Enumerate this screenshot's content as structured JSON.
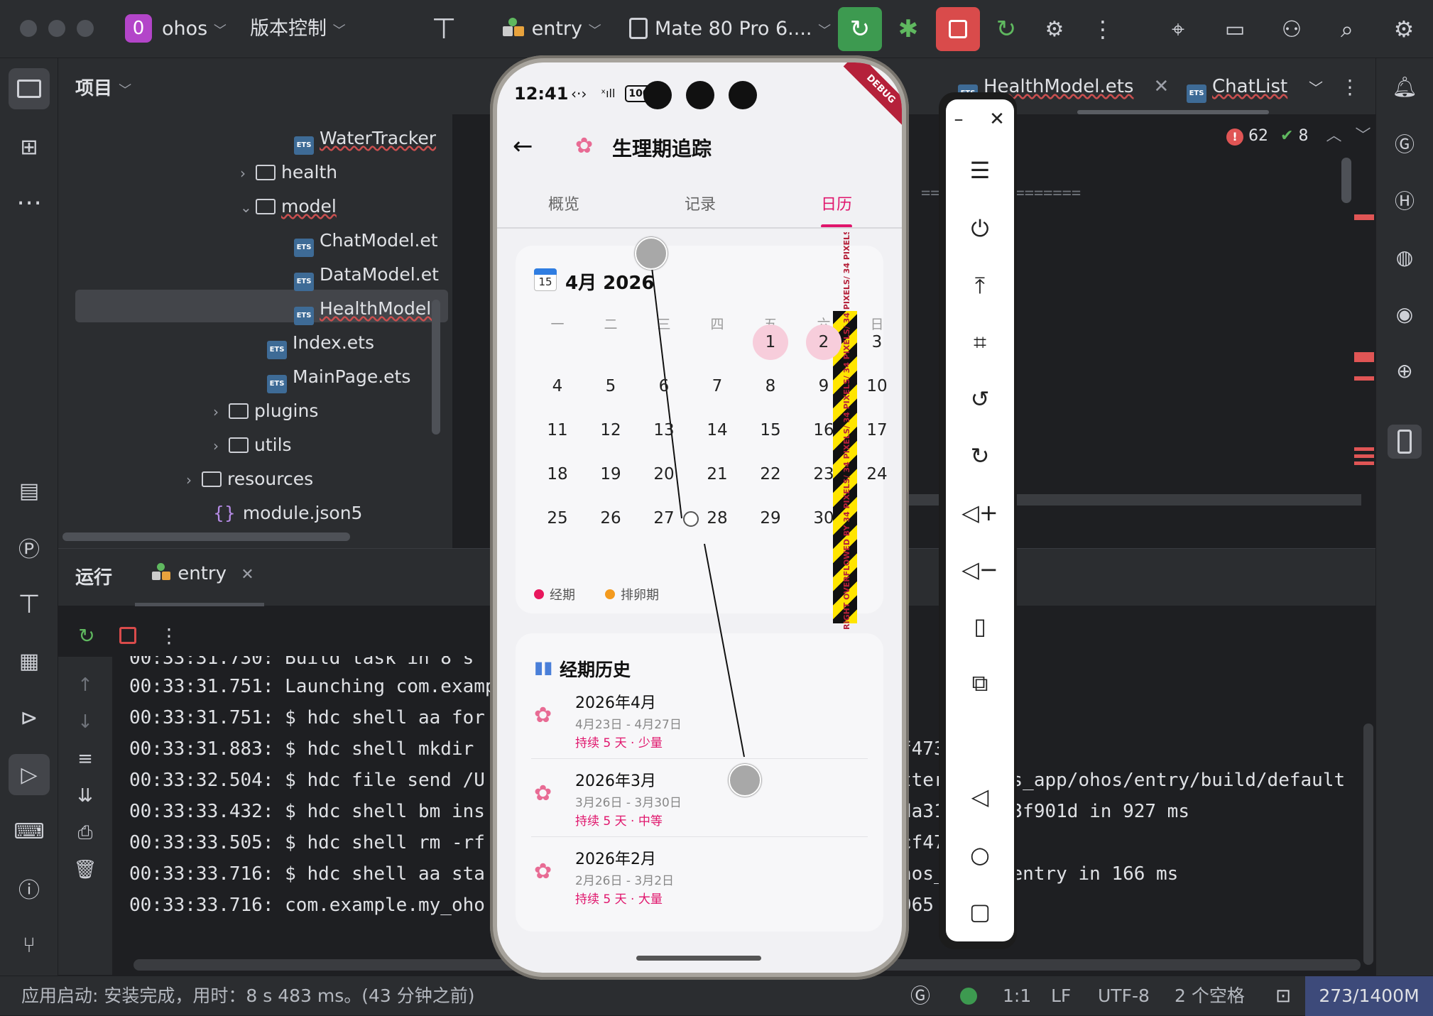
{
  "titlebar": {
    "project_badge": "0",
    "project_name": "ohos",
    "vcs_menu": "版本控制",
    "run_config": "entry",
    "device": "Mate 80 Pro 6....",
    "colors": {
      "run_green": "#3d9a50",
      "stop_red": "#d94b4b",
      "badge_purple": "#b345c9"
    }
  },
  "project_panel": {
    "title": "项目",
    "tree": [
      {
        "label": "WaterTracker",
        "kind": "ets"
      },
      {
        "label": "health",
        "kind": "folder-collapsed"
      },
      {
        "label": "model",
        "kind": "folder-expanded"
      },
      {
        "label": "ChatModel.et",
        "kind": "ets"
      },
      {
        "label": "DataModel.et",
        "kind": "ets"
      },
      {
        "label": "HealthModel.",
        "kind": "ets",
        "selected": true
      },
      {
        "label": "Index.ets",
        "kind": "ets"
      },
      {
        "label": "MainPage.ets",
        "kind": "ets"
      },
      {
        "label": "plugins",
        "kind": "folder-collapsed"
      },
      {
        "label": "utils",
        "kind": "folder-collapsed"
      },
      {
        "label": "resources",
        "kind": "folder-collapsed"
      },
      {
        "label": "module.json5",
        "kind": "json"
      }
    ]
  },
  "editor": {
    "tabs": [
      {
        "label": "HealthModel.ets"
      },
      {
        "label": "ChatList"
      }
    ],
    "error_count": "62",
    "warning_count": "8",
    "code_fragment": "==  ============="
  },
  "run_panel": {
    "title": "运行",
    "tab_label": "entry",
    "log_lines": [
      "00:33:31.730: Build task in 8 s",
      "00:33:31.751: Launching com.examp",
      "00:33:31.751: $ hdc shell aa for",
      "00:33:31.883: $ hdc shell mkdir",
      "00:33:32.504: $ hdc file send /U",
      "00:33:33.432: $ hdc shell bm ins",
      "00:33:33.505: $ hdc shell rm -rf",
      "00:33:33.716: $ hdc shell aa sta",
      "00:33:33.716: com.example.my_oho"
    ],
    "log_right": [
      {
        "line": 3,
        "text": "f473"
      },
      {
        "line": 4,
        "text": "tter     os_app/ohos/entry/build/default"
      },
      {
        "line": 5,
        "text": "da31     73f901d in 927 ms"
      },
      {
        "line": 6,
        "text": "cf47"
      },
      {
        "line": 7,
        "text": "hos_      entry in 166 ms"
      },
      {
        "line": 8,
        "text": "965"
      }
    ]
  },
  "statusbar": {
    "message": "应用启动: 安装完成，用时：8 s 483 ms。(43 分钟之前)",
    "position": "1:1",
    "line_ending": "LF",
    "encoding": "UTF-8",
    "indent": "2 个空格",
    "memory": "273/1400M"
  },
  "phone": {
    "time": "12:41",
    "battery": "100",
    "debug_ribbon": "DEBUG",
    "app_title": "生理期追踪",
    "tabs": [
      {
        "label": "概览"
      },
      {
        "label": "记录"
      },
      {
        "label": "日历",
        "active": true
      }
    ],
    "calendar": {
      "month_label": "4月 2026",
      "icon_day": "15",
      "weekdays": [
        "一",
        "二",
        "三",
        "四",
        "五",
        "六",
        "日"
      ],
      "rows": [
        [
          "",
          "",
          "",
          "",
          "1",
          "2",
          "3"
        ],
        [
          "4",
          "5",
          "6",
          "7",
          "8",
          "9",
          "10"
        ],
        [
          "11",
          "12",
          "13",
          "14",
          "15",
          "16",
          "17"
        ],
        [
          "18",
          "19",
          "20",
          "21",
          "22",
          "23",
          "24"
        ],
        [
          "25",
          "26",
          "27",
          "28",
          "29",
          "30",
          ""
        ]
      ],
      "highlighted_days": [
        "1",
        "2"
      ],
      "legend": [
        {
          "label": "经期",
          "color": "#e8175d"
        },
        {
          "label": "排卵期",
          "color": "#f39a1e"
        }
      ],
      "overflow_text": "RIGHT OVERFLOWED BY 34 PIXELS/ 34 PIXELS/ 34 PIXELS/ 34 PIXELS/ 34 PIXELS/ 34 PIXELS"
    },
    "history": {
      "title": "经期历史",
      "items": [
        {
          "month": "2026年4月",
          "range": "4月23日 - 4月27日",
          "detail": "持续 5 天 · 少量"
        },
        {
          "month": "2026年3月",
          "range": "3月26日 - 3月30日",
          "detail": "持续 5 天 · 中等"
        },
        {
          "month": "2026年2月",
          "range": "2月26日 - 3月2日",
          "detail": "持续 5 天 · 大量"
        }
      ]
    },
    "colors": {
      "accent": "#e0156c",
      "highlight_bg": "#f7cddb"
    }
  }
}
